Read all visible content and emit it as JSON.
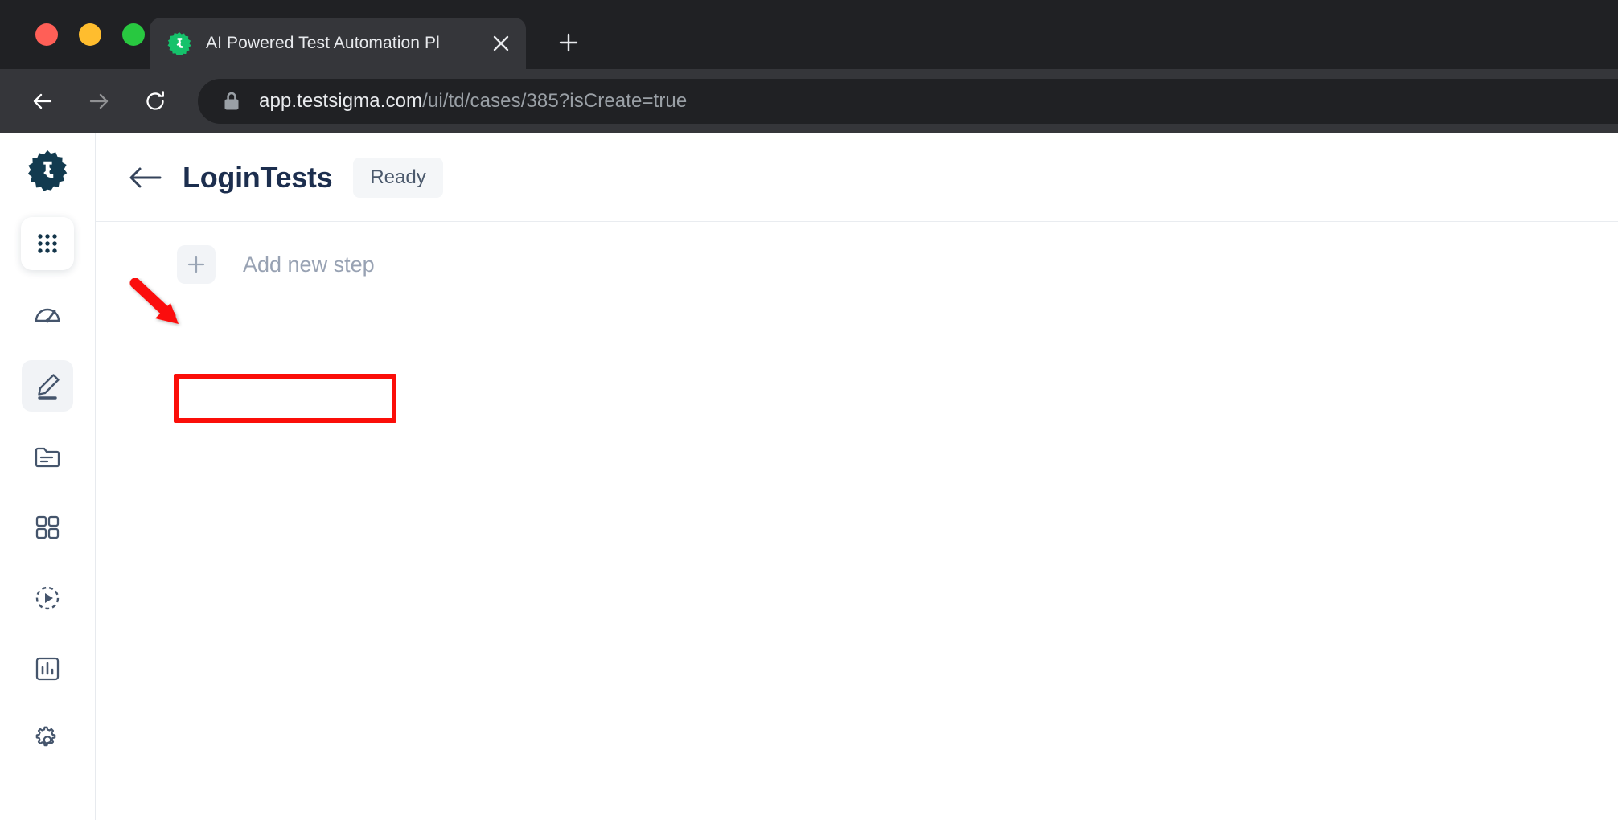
{
  "browser": {
    "window_controls": [
      {
        "name": "close",
        "color": "#ff5f57"
      },
      {
        "name": "minimize",
        "color": "#ffbd2e"
      },
      {
        "name": "maximize",
        "color": "#28c840"
      }
    ],
    "tab": {
      "title": "AI Powered Test Automation Pl",
      "favicon": "testsigma-logo-icon",
      "close_label": "×"
    },
    "new_tab_label": "+",
    "nav": {
      "back_icon": "arrow-left-icon",
      "forward_icon": "arrow-right-icon",
      "reload_icon": "reload-icon"
    },
    "omnibox": {
      "lock_icon": "lock-icon",
      "url_host": "app.testsigma.com",
      "url_path": "/ui/td/cases/385?isCreate=true"
    }
  },
  "sidebar": {
    "logo_icon": "testsigma-gear-logo-icon",
    "apps_label": "apps-grid-icon",
    "items": [
      {
        "icon": "speedometer-icon",
        "name": "dashboard",
        "active": false
      },
      {
        "icon": "pencil-icon",
        "name": "test-development",
        "active": true
      },
      {
        "icon": "folder-icon",
        "name": "test-data",
        "active": false
      },
      {
        "icon": "grid-squares-icon",
        "name": "test-plans",
        "active": false
      },
      {
        "icon": "play-circle-icon",
        "name": "runs",
        "active": false
      },
      {
        "icon": "bar-chart-icon",
        "name": "reports",
        "active": false
      },
      {
        "icon": "gear-icon",
        "name": "settings",
        "active": false
      }
    ]
  },
  "header": {
    "back_icon": "arrow-left-icon",
    "title": "LoginTests",
    "status": "Ready"
  },
  "main": {
    "add_step": {
      "plus_icon": "plus-icon",
      "label": "Add new step"
    }
  },
  "annotations": {
    "highlight_color": "#fb0e09",
    "box_target": "add-new-step-button",
    "arrow_target": "back-arrow"
  }
}
